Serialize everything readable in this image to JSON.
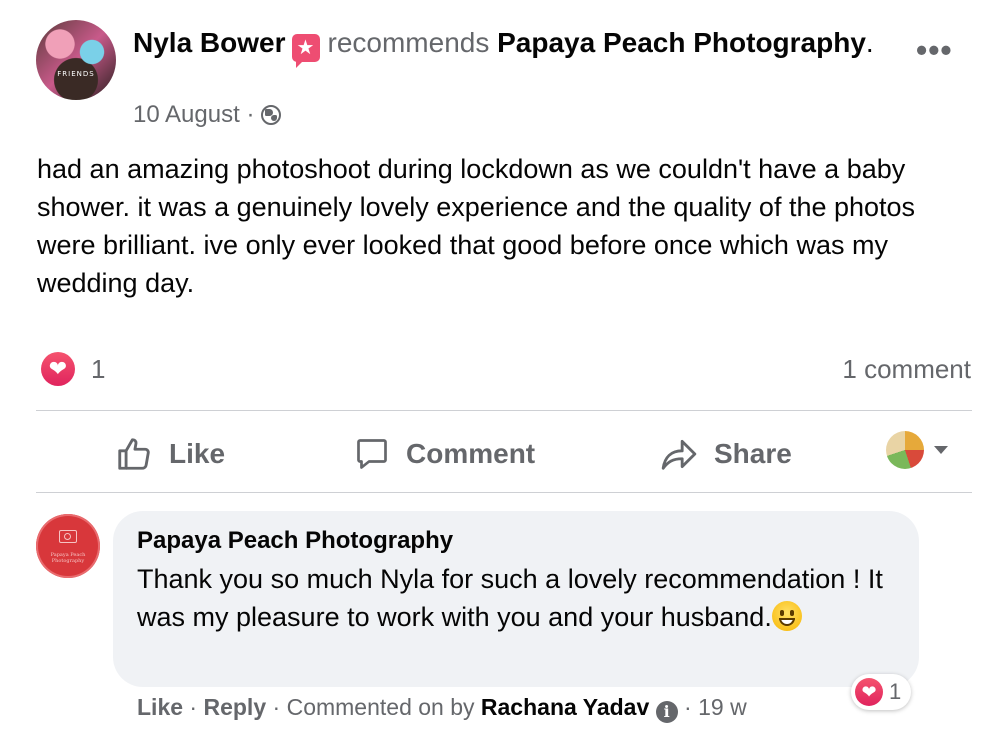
{
  "post": {
    "author": "Nyla Bower",
    "verb": "recommends",
    "page_name": "Papaya Peach Photography",
    "punct": ".",
    "date": "10 August",
    "separator": "·",
    "text": "had an amazing photoshoot during lockdown as we couldn't have a baby shower. it was a genuinely lovely experience and the quality of the photos were brilliant. ive only ever looked that good before once which was my wedding day.",
    "avatar_caption": "FRIENDS"
  },
  "stats": {
    "reaction_count": "1",
    "comment_count": "1 comment"
  },
  "actions": {
    "like": "Like",
    "comment": "Comment",
    "share": "Share"
  },
  "comment": {
    "author": "Papaya Peach Photography",
    "avatar_caption": "Papaya Peach Photography",
    "text": "Thank you so much Nyla for such a lovely recommendation ! It was my pleasure to work with you and your husband.",
    "reaction_count": "1",
    "like": "Like",
    "reply": "Reply",
    "commented_on_by": "Commented on by",
    "commenter": "Rachana Yadav",
    "age": "19 w"
  },
  "colors": {
    "accent_red": "#e0245e",
    "muted": "#65676b",
    "bubble": "#f0f2f5"
  }
}
